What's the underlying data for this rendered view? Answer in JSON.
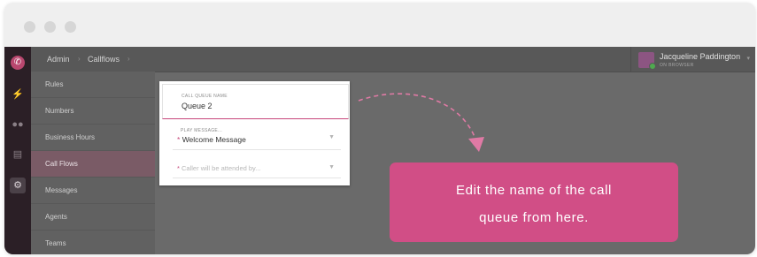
{
  "breadcrumb": {
    "admin": "Admin",
    "callflows": "Callflows"
  },
  "user": {
    "name": "Jacqueline Paddington",
    "status": "ON BROWSER"
  },
  "sidebar": {
    "items": [
      {
        "label": "Rules"
      },
      {
        "label": "Numbers"
      },
      {
        "label": "Business Hours"
      },
      {
        "label": "Call Flows",
        "active": true
      },
      {
        "label": "Messages"
      },
      {
        "label": "Agents"
      },
      {
        "label": "Teams"
      }
    ]
  },
  "form": {
    "queue_name_label": "CALL QUEUE NAME",
    "queue_name_value": "Queue 2",
    "play_message_label": "PLAY MESSAGE...",
    "play_message_value": "Welcome Message",
    "required_mark": "*",
    "caller_attended_placeholder": "Caller will be attended by..."
  },
  "tooltip": {
    "line1": "Edit the name of the call",
    "line2": "queue from here."
  },
  "colors": {
    "accent": "#d14e86",
    "rail": "#2b1f26",
    "overlay_gray": "#6a6a6a"
  },
  "icons": {
    "logo": "phone-logo-icon",
    "rail": [
      "bolt-icon",
      "people-icon",
      "contact-card-icon",
      "settings-gear-icon"
    ],
    "select_caret": "chevron-down-icon"
  }
}
